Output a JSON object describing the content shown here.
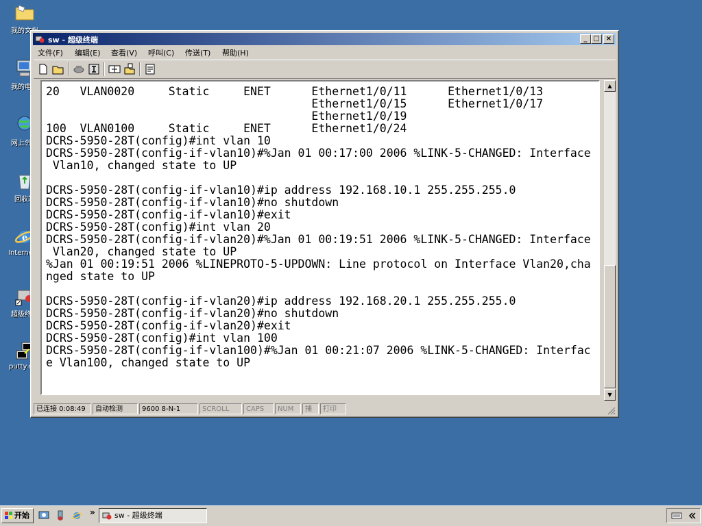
{
  "desktop": {
    "icons": [
      {
        "label": "我的文档"
      },
      {
        "label": "我的电脑"
      },
      {
        "label": "网上邻居"
      },
      {
        "label": "回收站"
      },
      {
        "label": "Internet Explorer"
      },
      {
        "label": "超级终端"
      },
      {
        "label": "putty.exe"
      }
    ]
  },
  "window": {
    "title": "sw - 超级终端",
    "controls": {
      "minimize": "_",
      "maximize": "□",
      "close": "×"
    }
  },
  "menu": {
    "items": [
      {
        "label": "文件(F)"
      },
      {
        "label": "编辑(E)"
      },
      {
        "label": "查看(V)"
      },
      {
        "label": "呼叫(C)"
      },
      {
        "label": "传送(T)"
      },
      {
        "label": "帮助(H)"
      }
    ]
  },
  "terminal": {
    "lines": [
      "20   VLAN0020     Static     ENET      Ethernet1/0/11      Ethernet1/0/13",
      "                                       Ethernet1/0/15      Ethernet1/0/17",
      "                                       Ethernet1/0/19",
      "100  VLAN0100     Static     ENET      Ethernet1/0/24",
      "DCRS-5950-28T(config)#int vlan 10",
      "DCRS-5950-28T(config-if-vlan10)#%Jan 01 00:17:00 2006 %LINK-5-CHANGED: Interface",
      " Vlan10, changed state to UP",
      "",
      "DCRS-5950-28T(config-if-vlan10)#ip address 192.168.10.1 255.255.255.0",
      "DCRS-5950-28T(config-if-vlan10)#no shutdown",
      "DCRS-5950-28T(config-if-vlan10)#exit",
      "DCRS-5950-28T(config)#int vlan 20",
      "DCRS-5950-28T(config-if-vlan20)#%Jan 01 00:19:51 2006 %LINK-5-CHANGED: Interface",
      " Vlan20, changed state to UP",
      "%Jan 01 00:19:51 2006 %LINEPROTO-5-UPDOWN: Line protocol on Interface Vlan20,cha",
      "nged state to UP",
      "",
      "DCRS-5950-28T(config-if-vlan20)#ip address 192.168.20.1 255.255.255.0",
      "DCRS-5950-28T(config-if-vlan20)#no shutdown",
      "DCRS-5950-28T(config-if-vlan20)#exit",
      "DCRS-5950-28T(config)#int vlan 100",
      "DCRS-5950-28T(config-if-vlan100)#%Jan 01 00:21:07 2006 %LINK-5-CHANGED: Interfac",
      "e Vlan100, changed state to UP",
      "",
      "_"
    ]
  },
  "status": {
    "connected": "已连接 0:08:49",
    "detect": "自动检测",
    "settings": "9600 8-N-1",
    "scroll": "SCROLL",
    "caps": "CAPS",
    "num": "NUM",
    "capture": "捕",
    "print": "打印"
  },
  "taskbar": {
    "start": "开始",
    "chevron": "»",
    "task_title": "sw - 超级终端"
  }
}
